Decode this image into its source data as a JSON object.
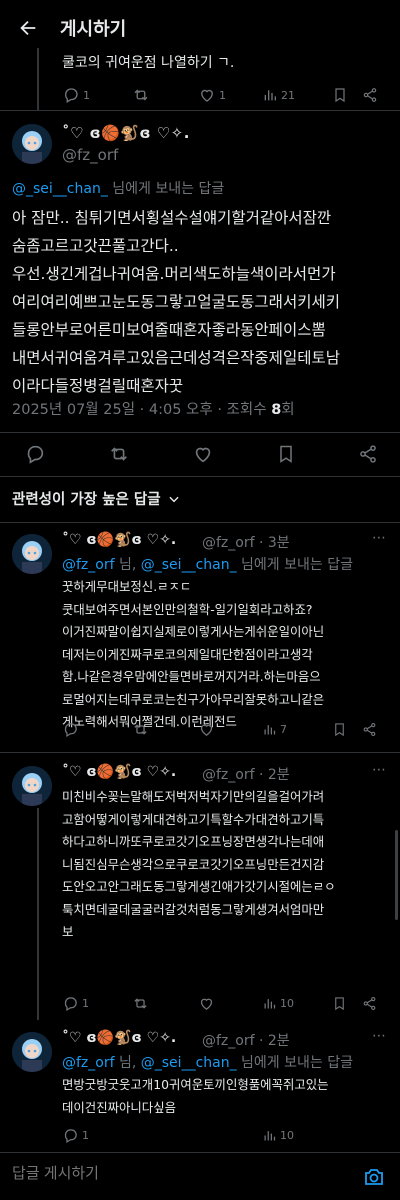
{
  "header": {
    "title": "게시하기"
  },
  "prev_tweet": {
    "text": "쿨코의 귀여운점 나열하기 ㄱ.",
    "replies": "1",
    "retweets": "",
    "likes": "1",
    "views": "21"
  },
  "main_tweet": {
    "display_name": "˚♡ ɞ🏀🐒ɞ ♡✧.",
    "handle": "@fz_orf",
    "reply_to_user": "@_sei__chan_",
    "reply_to_suffix": "님에게 보내는 답글",
    "lines": [
      "아 잠만.. 침튀기면서횡설수설얘기할거같아서잠깐",
      "숨좀고르고갓끈풀고간다..",
      "우선.생긴게겁나귀여움.머리색도하늘색이라서먼가",
      "여리여리예쁘고눈도동그랗고얼굴도동그래서키세키",
      "들롱안부로어른미보여줄때혼자좋라동안페이스뽐",
      "내면서귀여움겨루고있음근데성격은작중제일테토남",
      "이라다들정병걸릴때혼자꿋"
    ],
    "timestamp": "2025년 07월 25일 · 4:05 오후 · 조회수 ",
    "views": "8",
    "views_suffix": "회"
  },
  "sort_label": "관련성이 가장 높은 답글",
  "replies": [
    {
      "display_name": "˚♡ ɞ🏀🐒ɞ ♡✧.",
      "handle": "@fz_orf · 3분",
      "reply_to_a": "@fz_orf",
      "reply_to_sep": " 님, ",
      "reply_to_b": "@_sei__chan_",
      "reply_to_suffix": " 님에게 보내는 답글",
      "lines": [
        "꿋하게무대보정신.ㄹㅈㄷ",
        "쿳대보여주면서본인만의철학-일기일회라고하죠?",
        "이거진짜말이쉽지실제로이렇게사는게쉬운일이아닌",
        "데저는이게진짜쿠로코의제일대단한점이라고생각",
        "함.나같은경우맘에안들면바로꺼지거라.하는마음으",
        "로멀어지는데쿠로코는친구가아무리잘못하고니같은",
        "게노력해서뭐어쩔건데.이런레전드"
      ],
      "replies": "",
      "retweets": "",
      "likes": "",
      "views": "7"
    },
    {
      "display_name": "˚♡ ɞ🏀🐒ɞ ♡✧.",
      "handle": "@fz_orf · 2분",
      "lines": [
        "미친비수꽂는말해도저벅저벅자기만의길을걸어가려",
        "고함어떻게이렇게대견하고기특할수가대견하고기특",
        "하다고하니까또쿠로코갓기오프닝장면생각나는데애",
        "니됨진심무슨생각으로쿠로코갓기오프닝만든건지감",
        "도안오고안그래도동그랗게생긴애가갓기시절에는ㄹㅇ",
        "툭치면데굴데굴굴러갈것처럼동그랗게생겨서엄마만",
        "보"
      ],
      "replies": "1",
      "retweets": "",
      "likes": "",
      "views": "10"
    },
    {
      "display_name": "˚♡ ɞ🏀🐒ɞ ♡✧.",
      "handle": "@fz_orf · 2분",
      "reply_to_a": "@fz_orf",
      "reply_to_sep": " 님, ",
      "reply_to_b": "@_sei__chan_",
      "reply_to_suffix": " 님에게 보내는 답글",
      "lines": [
        "면방굿방굿웃고개10귀여운토끼인형품에꼭쥐고있는",
        "데이건진짜아니다싶음"
      ],
      "replies": "1",
      "retweets": "",
      "likes": "",
      "views": "10"
    }
  ],
  "compose": {
    "placeholder": "답글 게시하기"
  },
  "colors": {
    "accent": "#1d9bf0",
    "muted": "#71767b",
    "background": "#000000",
    "text": "#e7e9ea"
  }
}
